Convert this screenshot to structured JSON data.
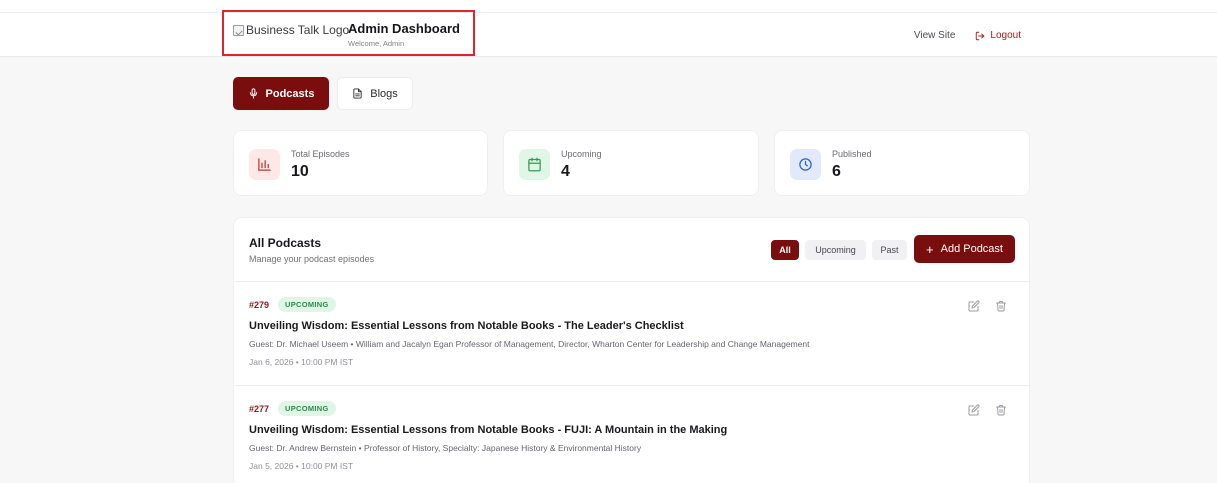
{
  "header": {
    "logo_alt": "Business Talk Logo",
    "title": "Admin Dashboard",
    "welcome": "Welcome, Admin",
    "view_site": "View Site",
    "logout": "Logout"
  },
  "tabs": [
    {
      "label": "Podcasts",
      "active": true,
      "icon": "microphone-icon"
    },
    {
      "label": "Blogs",
      "active": false,
      "icon": "document-icon"
    }
  ],
  "stats": [
    {
      "label": "Total Episodes",
      "value": "10",
      "icon": "bar-chart-icon",
      "color": "#c0392b",
      "bg": "#fde8e8"
    },
    {
      "label": "Upcoming",
      "value": "4",
      "icon": "calendar-icon",
      "color": "#2e9e55",
      "bg": "#e0f6e6"
    },
    {
      "label": "Published",
      "value": "6",
      "icon": "clock-icon",
      "color": "#2e62c9",
      "bg": "#e1e9fa"
    }
  ],
  "panel": {
    "title": "All Podcasts",
    "subtitle": "Manage your podcast episodes",
    "filters": [
      "All",
      "Upcoming",
      "Past"
    ],
    "add_label": "Add Podcast"
  },
  "episodes": [
    {
      "number": "#279",
      "badge": "UPCOMING",
      "title": "Unveiling Wisdom: Essential Lessons from Notable Books - The Leader's Checklist",
      "guest": "Guest: Dr. Michael Useem • William and Jacalyn Egan Professor of Management, Director, Wharton Center for Leadership and Change Management",
      "date": "Jan 6, 2026 • 10:00 PM IST"
    },
    {
      "number": "#277",
      "badge": "UPCOMING",
      "title": "Unveiling Wisdom: Essential Lessons from Notable Books - FUJI: A Mountain in the Making",
      "guest": "Guest: Dr. Andrew Bernstein • Professor of History, Specialty: Japanese History & Environmental History",
      "date": "Jan 5, 2026 • 10:00 PM IST"
    }
  ],
  "colors": {
    "accent": "#7a0d0d",
    "highlight_box": "#e2222c",
    "badge_green": "#2f8a4a"
  }
}
